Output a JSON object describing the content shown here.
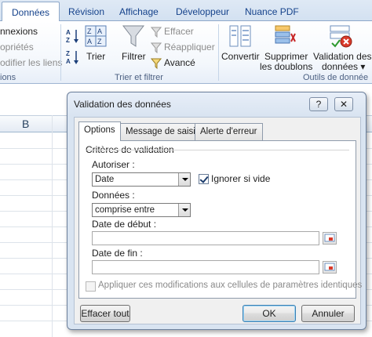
{
  "ribbon": {
    "tabs": [
      "Données",
      "Révision",
      "Affichage",
      "Développeur",
      "Nuance PDF"
    ],
    "connexions_group": {
      "items": [
        "nnexions",
        "opriétés",
        "odifier les liens"
      ],
      "label": "ions"
    },
    "sort_filter_group": {
      "tri_label": "Trier",
      "filtrer_label": "Filtrer",
      "effacer_label": "Effacer",
      "reappliquer_label": "Réappliquer",
      "avance_label": "Avancé",
      "label": "Trier et filtrer"
    },
    "tools_group": {
      "convertir_label": "Convertir",
      "supprimer_label_1": "Supprimer",
      "supprimer_label_2": "les doublons",
      "validation_label_1": "Validation des",
      "validation_label_2": "données ▾",
      "label": "Outils de donnée"
    },
    "colors": {
      "tab_text": "#15428b",
      "group_label": "#4d6182"
    }
  },
  "sheet": {
    "column_b": "B"
  },
  "dialog": {
    "title": "Validation des données",
    "help_glyph": "?",
    "close_glyph": "✕",
    "tabs": [
      "Options",
      "Message de saisie",
      "Alerte d'erreur"
    ],
    "section_title": "Critères de validation",
    "autoriser_label": "Autoriser :",
    "autoriser_value": "Date",
    "ignorer_vide_label": "Ignorer si vide",
    "ignorer_vide_checked": true,
    "donnees_label": "Données :",
    "donnees_value": "comprise entre",
    "date_debut_label": "Date de début :",
    "date_debut_value": "",
    "date_fin_label": "Date de fin :",
    "date_fin_value": "",
    "appliquer_label": "Appliquer ces modifications aux cellules de paramètres identiques",
    "appliquer_checked": false,
    "effacer_tout_label": "Effacer tout",
    "ok_label": "OK",
    "annuler_label": "Annuler"
  }
}
